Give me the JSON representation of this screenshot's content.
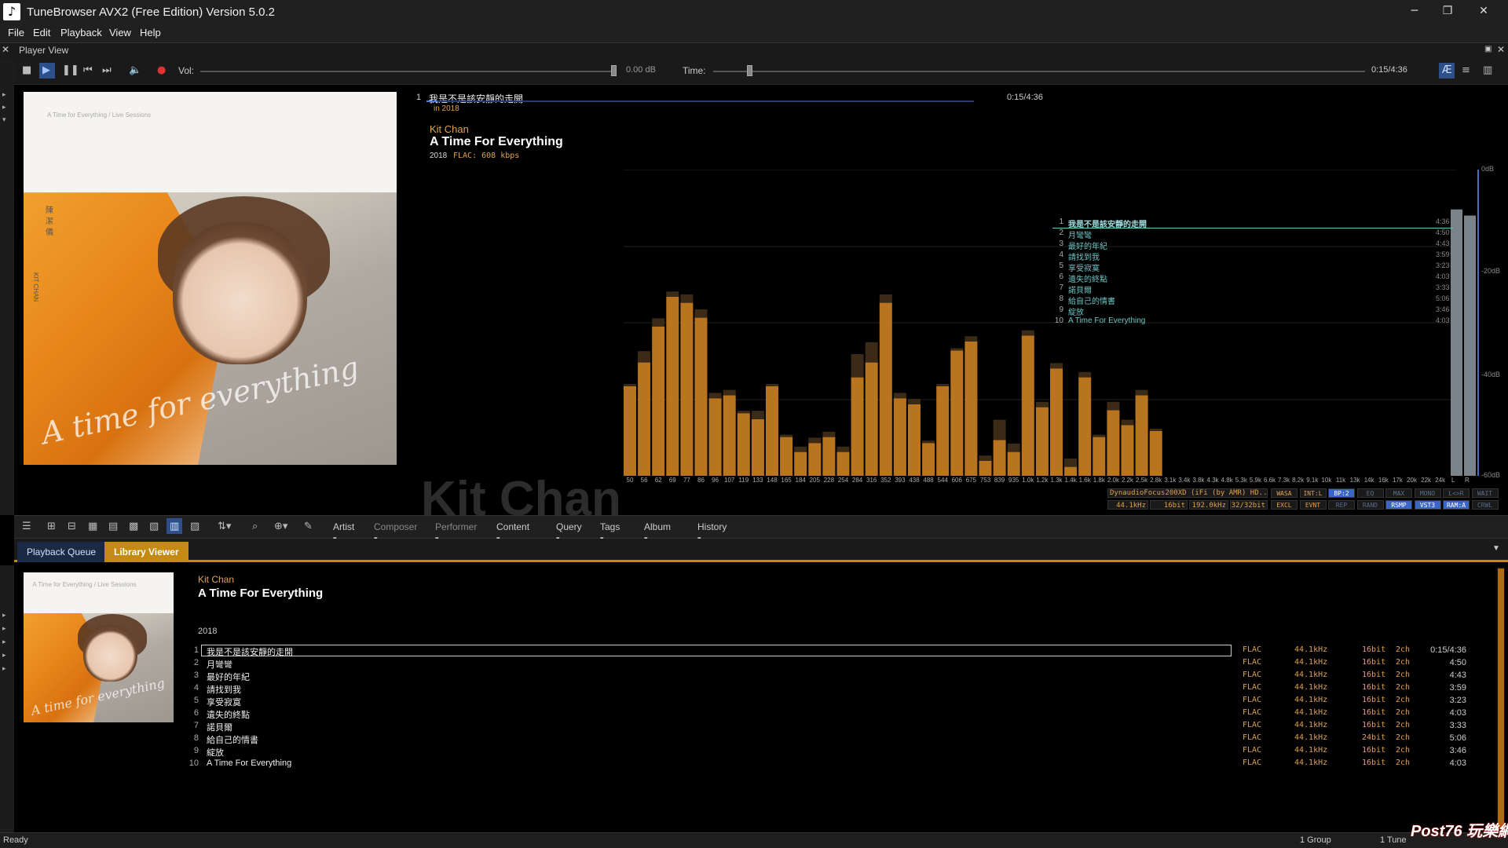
{
  "app": {
    "title": "TuneBrowser AVX2 (Free Edition) Version 5.0.2",
    "icon": "music-note-icon"
  },
  "menu": [
    "File",
    "Edit",
    "Playback",
    "View",
    "Help"
  ],
  "player_view": {
    "header": "Player View",
    "volume_label": "Vol:",
    "volume_value": "0.00 dB",
    "time_label": "Time:",
    "time_value": "0:15/4:36"
  },
  "now_playing": {
    "track_no": "1",
    "track_title": "我是不是該安靜的走開",
    "sub": "in 2018",
    "position": "0:15/4:36",
    "artist": "Kit Chan",
    "album": "A Time For Everything",
    "year": "2018",
    "format": "FLAC: 608 kbps",
    "watermark": "Kit Chan"
  },
  "cover": {
    "top_text": "A Time for Everything  /  Live Sessions",
    "vertical_cn": "陳潔儀",
    "vertical_en": "KIT CHAN",
    "script": "A time for everything"
  },
  "overlay_tracks": [
    {
      "no": "1",
      "title": "我是不是該安靜的走開",
      "time": "4:36"
    },
    {
      "no": "2",
      "title": "月彎彎",
      "time": "4:50"
    },
    {
      "no": "3",
      "title": "最好的年紀",
      "time": "4:43"
    },
    {
      "no": "4",
      "title": "請找到我",
      "time": "3:59"
    },
    {
      "no": "5",
      "title": "享受寂寞",
      "time": "3:23"
    },
    {
      "no": "6",
      "title": "遺失的終點",
      "time": "4:03"
    },
    {
      "no": "7",
      "title": "諾貝爾",
      "time": "3:33"
    },
    {
      "no": "8",
      "title": "給自己的情書",
      "time": "5:06"
    },
    {
      "no": "9",
      "title": "綻放",
      "time": "3:46"
    },
    {
      "no": "10",
      "title": "A Time For Everything",
      "time": "4:03"
    }
  ],
  "spectrum": {
    "db_labels": [
      "0dB",
      "-20dB",
      "-40dB",
      "-60dB"
    ],
    "freq_labels": [
      "50",
      "56",
      "62",
      "69",
      "77",
      "86",
      "96",
      "107",
      "119",
      "133",
      "148",
      "165",
      "184",
      "205",
      "228",
      "254",
      "284",
      "316",
      "352",
      "393",
      "438",
      "488",
      "544",
      "606",
      "675",
      "753",
      "839",
      "935",
      "1.0k",
      "1.2k",
      "1.3k",
      "1.4k",
      "1.6k",
      "1.8k",
      "2.0k",
      "2.2k",
      "2.5k",
      "2.8k",
      "3.1k",
      "3.4k",
      "3.8k",
      "4.3k",
      "4.8k",
      "5.3k",
      "5.9k",
      "6.6k",
      "7.3k",
      "8.2k",
      "9.1k",
      "10k",
      "11k",
      "13k",
      "14k",
      "16k",
      "17k",
      "20k",
      "22k",
      "24k"
    ],
    "values": [
      0.3,
      0.38,
      0.5,
      0.6,
      0.58,
      0.53,
      0.26,
      0.27,
      0.21,
      0.19,
      0.3,
      0.13,
      0.08,
      0.11,
      0.13,
      0.08,
      0.33,
      0.38,
      0.58,
      0.26,
      0.24,
      0.11,
      0.3,
      0.42,
      0.45,
      0.05,
      0.12,
      0.08,
      0.47,
      0.23,
      0.36,
      0.03,
      0.33,
      0.13,
      0.22,
      0.17,
      0.27,
      0.15,
      0,
      0,
      0,
      0,
      0,
      0,
      0,
      0,
      0,
      0,
      0,
      0,
      0,
      0,
      0,
      0,
      0,
      0,
      0,
      0
    ],
    "peaks": [
      0.3,
      0.41,
      0.52,
      0.61,
      0.6,
      0.55,
      0.27,
      0.28,
      0.21,
      0.21,
      0.3,
      0.13,
      0.09,
      0.12,
      0.14,
      0.09,
      0.4,
      0.44,
      0.6,
      0.27,
      0.25,
      0.11,
      0.3,
      0.42,
      0.46,
      0.06,
      0.18,
      0.1,
      0.48,
      0.24,
      0.37,
      0.05,
      0.34,
      0.13,
      0.24,
      0.18,
      0.28,
      0.15,
      0,
      0,
      0,
      0,
      0,
      0,
      0,
      0,
      0,
      0,
      0,
      0,
      0,
      0,
      0,
      0,
      0,
      0,
      0,
      0
    ],
    "vu_labels": [
      "L",
      "R"
    ],
    "vu_values": [
      0.87,
      0.85
    ],
    "bar_color": "#b8741f"
  },
  "device": {
    "name": "DynaudioFocus200XD (iFi (by AMR) HD...",
    "row2": [
      "44.1kHz",
      "16bit",
      "192.0kHz",
      "32/32bit"
    ],
    "badges_row1": [
      "WASA",
      "INT:L",
      "BP:2",
      "EQ",
      "MAX",
      "MONO",
      "L<>R",
      "WAIT"
    ],
    "badges_row2": [
      "EXCL",
      "EVNT",
      "REP",
      "RAND",
      "RSMP",
      "VST3",
      "RAM:A",
      "CRWL"
    ]
  },
  "toolbar": {
    "menus": [
      "Artist",
      "Composer",
      "Performer",
      "Content",
      "Query",
      "Tags",
      "Album",
      "History"
    ]
  },
  "tabs": [
    "Playback Queue",
    "Library Viewer"
  ],
  "library": {
    "artist": "Kit Chan",
    "album": "A Time For Everything",
    "year": "2018",
    "tracks": [
      {
        "no": "1",
        "title": "我是不是該安靜的走開",
        "fmt": "FLAC",
        "rate": "44.1kHz",
        "bits": "16bit",
        "ch": "2ch",
        "time": "0:15/4:36"
      },
      {
        "no": "2",
        "title": "月彎彎",
        "fmt": "FLAC",
        "rate": "44.1kHz",
        "bits": "16bit",
        "ch": "2ch",
        "time": "4:50"
      },
      {
        "no": "3",
        "title": "最好的年紀",
        "fmt": "FLAC",
        "rate": "44.1kHz",
        "bits": "16bit",
        "ch": "2ch",
        "time": "4:43"
      },
      {
        "no": "4",
        "title": "請找到我",
        "fmt": "FLAC",
        "rate": "44.1kHz",
        "bits": "16bit",
        "ch": "2ch",
        "time": "3:59"
      },
      {
        "no": "5",
        "title": "享受寂寞",
        "fmt": "FLAC",
        "rate": "44.1kHz",
        "bits": "16bit",
        "ch": "2ch",
        "time": "3:23"
      },
      {
        "no": "6",
        "title": "遺失的終點",
        "fmt": "FLAC",
        "rate": "44.1kHz",
        "bits": "16bit",
        "ch": "2ch",
        "time": "4:03"
      },
      {
        "no": "7",
        "title": "諾貝爾",
        "fmt": "FLAC",
        "rate": "44.1kHz",
        "bits": "16bit",
        "ch": "2ch",
        "time": "3:33"
      },
      {
        "no": "8",
        "title": "給自己的情書",
        "fmt": "FLAC",
        "rate": "44.1kHz",
        "bits": "24bit",
        "ch": "2ch",
        "time": "5:06"
      },
      {
        "no": "9",
        "title": "綻放",
        "fmt": "FLAC",
        "rate": "44.1kHz",
        "bits": "16bit",
        "ch": "2ch",
        "time": "3:46"
      },
      {
        "no": "10",
        "title": "A Time For Everything",
        "fmt": "FLAC",
        "rate": "44.1kHz",
        "bits": "16bit",
        "ch": "2ch",
        "time": "4:03"
      }
    ]
  },
  "status": {
    "left": "Ready",
    "groups": "1 Group",
    "tunes": "1 Tune",
    "watermark": "Post76 玩樂網"
  },
  "colors": {
    "accent_orange": "#e0a250",
    "tab_active": "#c58a14",
    "overlay_text": "#6ec3c3"
  }
}
